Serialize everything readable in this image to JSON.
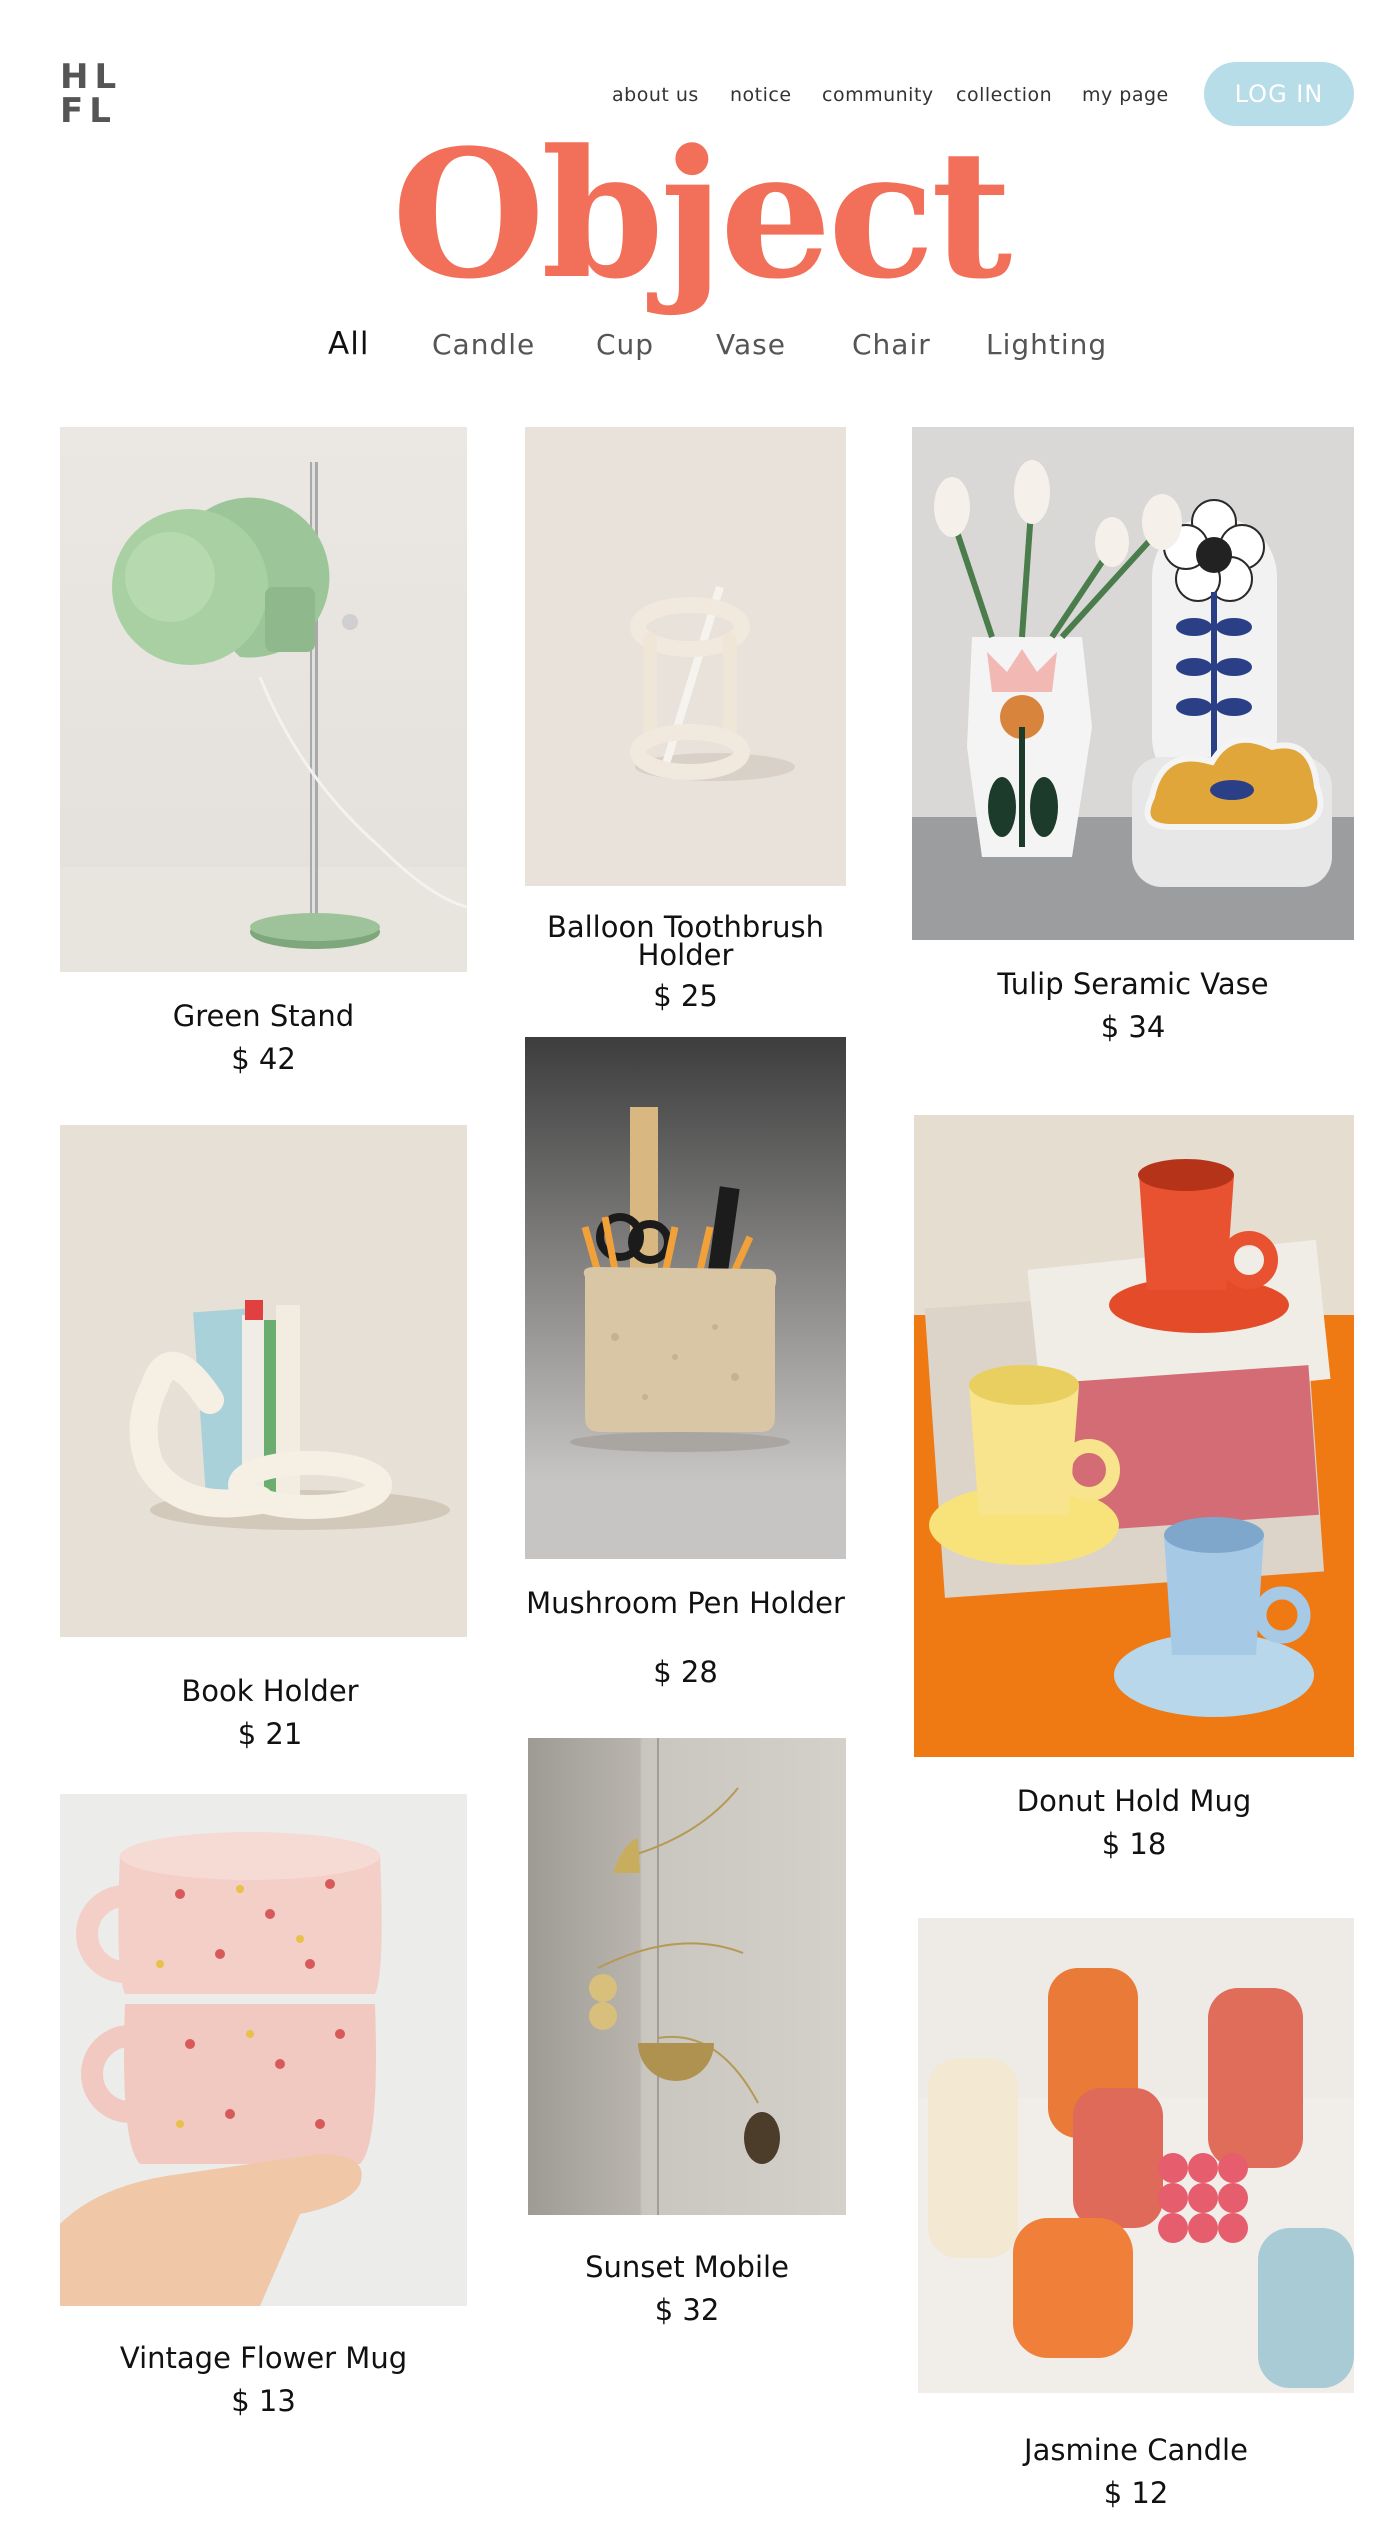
{
  "brand": {
    "line1": "HL",
    "line2": "FL"
  },
  "nav": {
    "links": [
      "about us",
      "notice",
      "community",
      "collection",
      "my page"
    ],
    "login_label": "LOG IN"
  },
  "page_title": "Object",
  "categories": [
    {
      "label": "All",
      "active": true
    },
    {
      "label": "Candle",
      "active": false
    },
    {
      "label": "Cup",
      "active": false
    },
    {
      "label": "Vase",
      "active": false
    },
    {
      "label": "Chair",
      "active": false
    },
    {
      "label": "Lighting",
      "active": false
    }
  ],
  "products": [
    {
      "name": "Green Stand",
      "price": "$ 42",
      "image": "green-desk-lamp"
    },
    {
      "name": "Balloon Toothbrush Holder",
      "price": "$ 25",
      "image": "ceramic-toothbrush-holder"
    },
    {
      "name": "Tulip Seramic Vase",
      "price": "$ 34",
      "image": "tulip-vases"
    },
    {
      "name": "Book Holder",
      "price": "$ 21",
      "image": "loop-book-holder"
    },
    {
      "name": "Mushroom Pen Holder",
      "price": "$ 28",
      "image": "pen-holder"
    },
    {
      "name": "Donut Hold Mug",
      "price": "$ 18",
      "image": "donut-mugs"
    },
    {
      "name": "Vintage Flower Mug",
      "price": "$ 13",
      "image": "flower-mugs"
    },
    {
      "name": "Sunset Mobile",
      "price": "$ 32",
      "image": "brass-mobile"
    },
    {
      "name": "Jasmine Candle",
      "price": "$ 12",
      "image": "flower-candles"
    }
  ],
  "colors": {
    "accent": "#f2705a",
    "login_bg": "#b7dde8"
  }
}
